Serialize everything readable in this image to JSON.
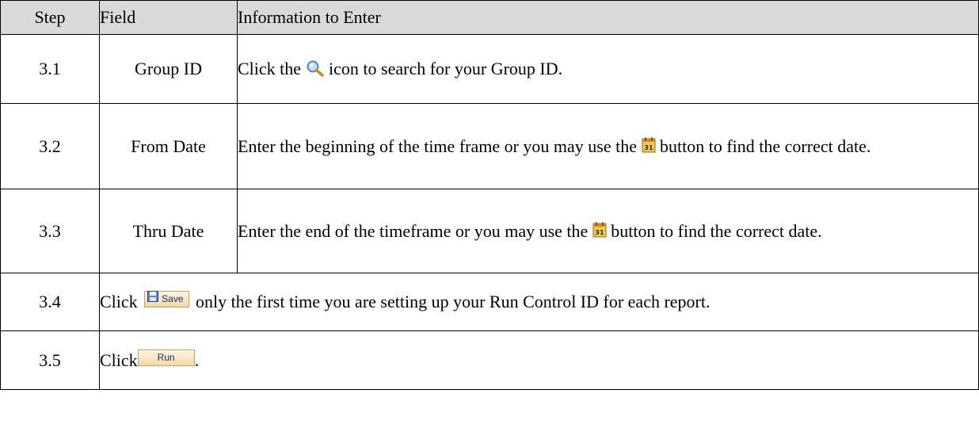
{
  "headers": {
    "step": "Step",
    "field": "Field",
    "info": "Information to Enter"
  },
  "rows": [
    {
      "step": "3.1",
      "field": "Group ID",
      "info_before": "Click the",
      "icon": "magnifier-search-icon",
      "info_after": "icon to search for your Group ID."
    },
    {
      "step": "3.2",
      "field": "From Date",
      "info_before": "Enter the beginning of the time frame or you may use the",
      "icon": "calendar-icon",
      "info_after": "button to find the correct date."
    },
    {
      "step": "3.3",
      "field": "Thru Date",
      "info_before": "Enter the end of the timeframe or you may use the",
      "icon": "calendar-icon",
      "info_after": "button to find the correct date."
    },
    {
      "step": "3.4",
      "info_before": "Click",
      "button_label": "Save",
      "button_icon": "floppy-disk-icon",
      "info_after": "only the first time you are setting up your Run Control ID for each report."
    },
    {
      "step": "3.5",
      "info_before": "Click",
      "button_label": "Run",
      "info_after": "."
    }
  ],
  "colors": {
    "header_bg": "#d9d9d9",
    "button_bg": "#f2d9a6",
    "button_border": "#c7a15d",
    "button_text": "#1b2f63"
  }
}
